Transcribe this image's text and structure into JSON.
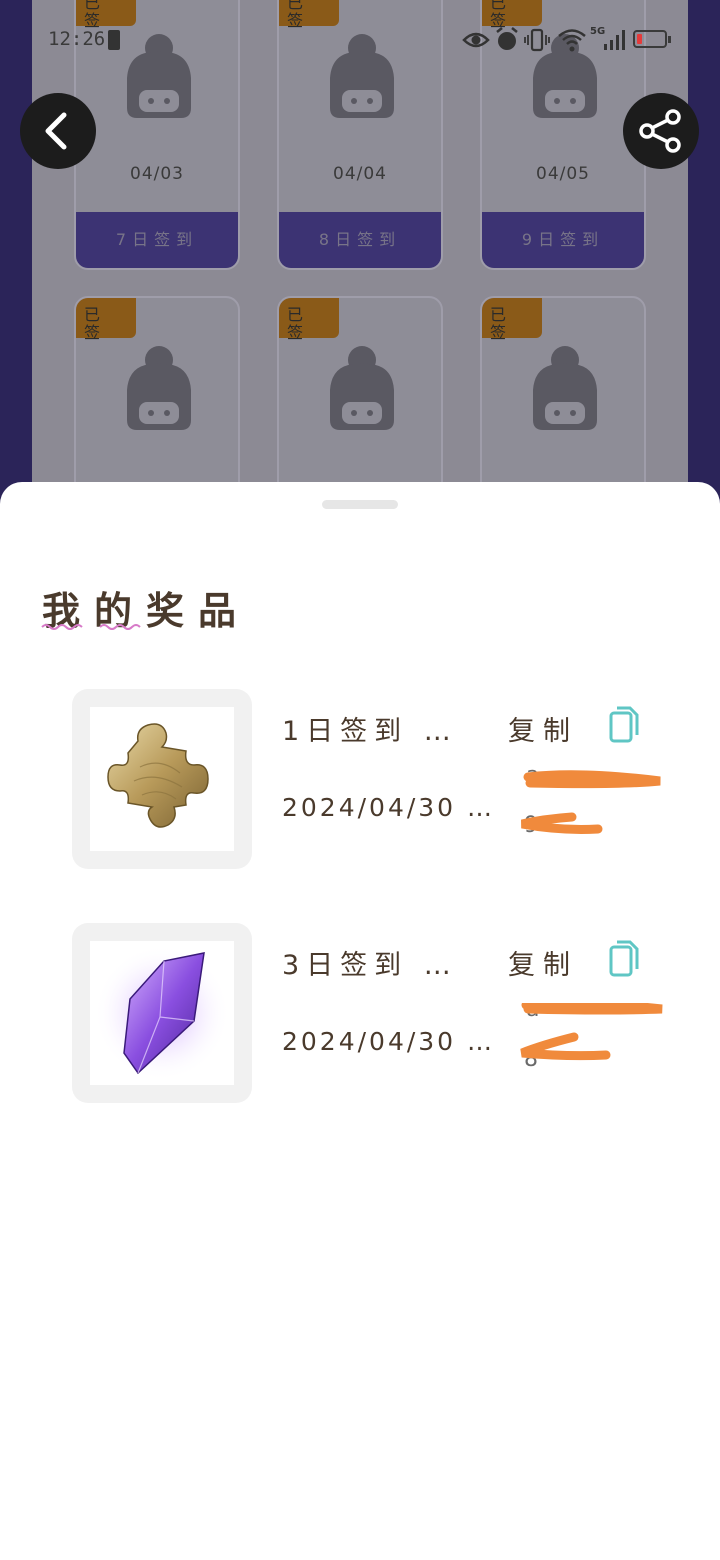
{
  "status_bar": {
    "time": "12:26",
    "network": "5G"
  },
  "background_cards": [
    {
      "tag": "已签",
      "date": "04/03",
      "button": "7日签到"
    },
    {
      "tag": "已签",
      "date": "04/04",
      "button": "8日签到"
    },
    {
      "tag": "已签",
      "date": "04/05",
      "button": "9日签到"
    },
    {
      "tag": "已签",
      "date": "",
      "button": ""
    },
    {
      "tag": "已签",
      "date": "",
      "button": ""
    },
    {
      "tag": "已签",
      "date": "",
      "button": ""
    }
  ],
  "sheet": {
    "title": "我的奖品",
    "prizes": [
      {
        "name": "1日签到 …",
        "date": "2024/04/30 …",
        "copy_label": "复制",
        "code_line1": "a",
        "code_line2": "9",
        "image": "puzzle-piece"
      },
      {
        "name": "3日签到 …",
        "date": "2024/04/30 …",
        "copy_label": "复制",
        "code_line1": "a",
        "code_line2": "8",
        "image": "purple-crystal"
      }
    ]
  },
  "colors": {
    "accent_orange": "#f08a3c",
    "copy_icon": "#5fc6c4",
    "sheet_text": "#4a3a2c",
    "bg_dark": "#2b2459"
  }
}
